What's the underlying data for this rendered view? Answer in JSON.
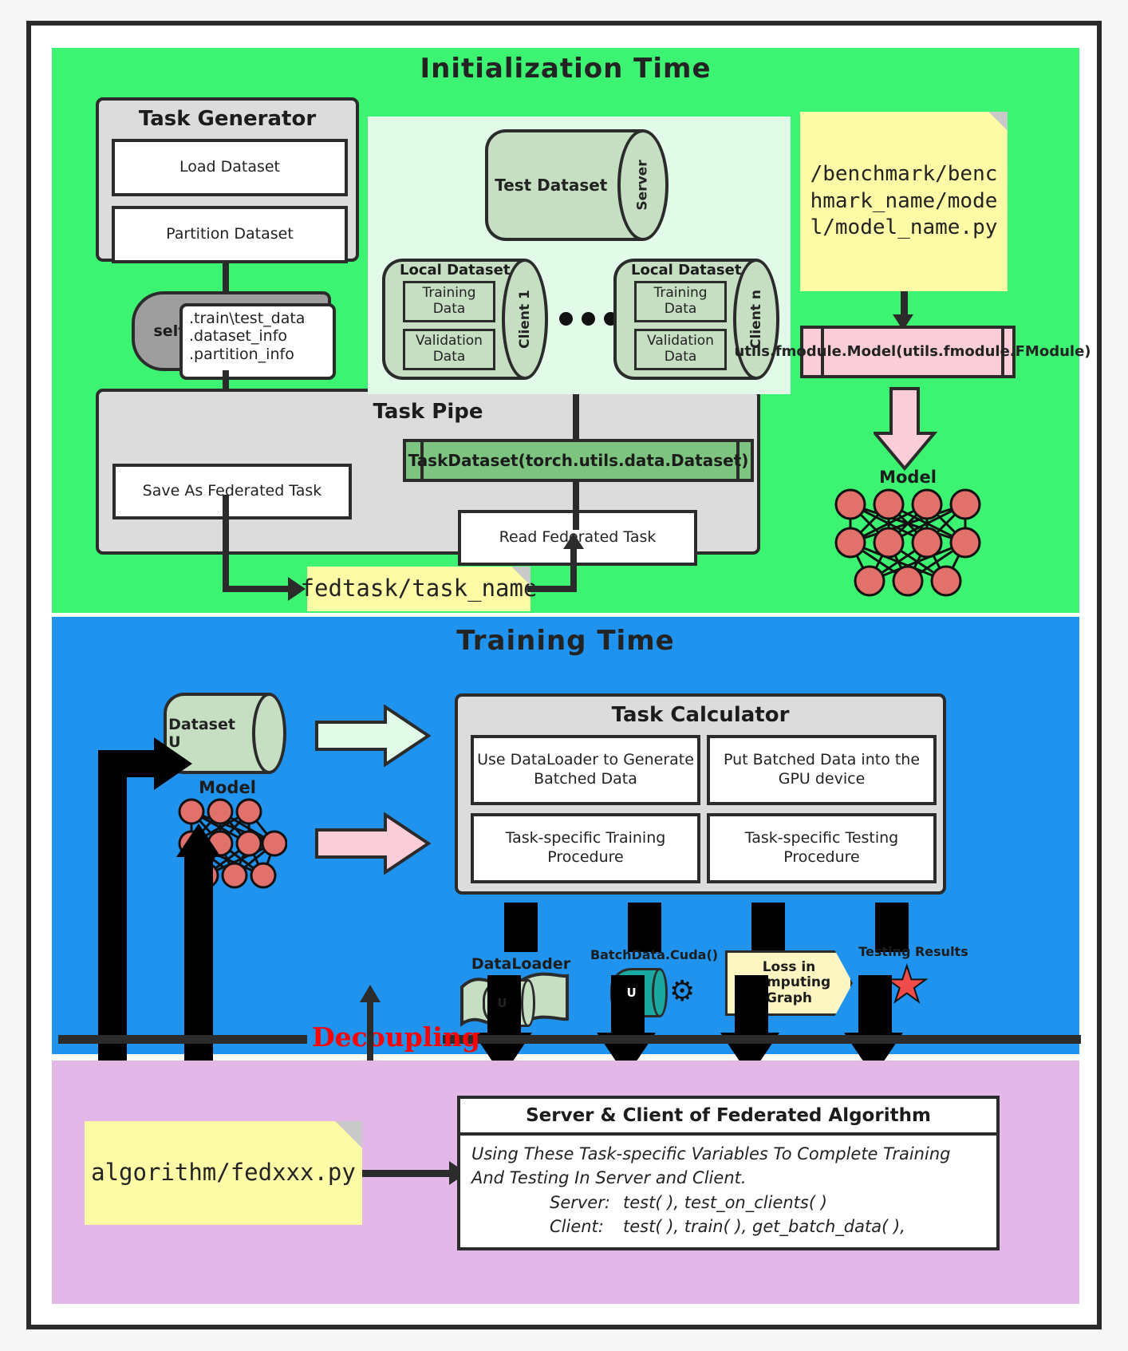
{
  "sections": {
    "init": {
      "title": "Initialization Time"
    },
    "train": {
      "title": "Training Time"
    },
    "decoupling": {
      "label": "Decoupling"
    }
  },
  "task_generator": {
    "title": "Task Generator",
    "items": [
      "Load Dataset",
      "Partition Dataset"
    ]
  },
  "self_note": {
    "tag": "self",
    "lines": [
      ".train\\test_data",
      ".dataset_info",
      ".partition_info"
    ]
  },
  "task_pipe": {
    "title": "Task Pipe",
    "save_box": "Save As Federated Task",
    "read_box": "Read Federated Task",
    "task_dataset_bar": "TaskDataset(torch.utils.data.Dataset)"
  },
  "fedtask_note": "fedtask/task_name",
  "data_panel": {
    "server_cylinder": {
      "label": "Test Dataset",
      "cap": "Server"
    },
    "clients": [
      {
        "title": "Local Dataset",
        "cap": "Client 1",
        "rows": [
          "Training Data",
          "Validation Data"
        ]
      },
      {
        "title": "Local Dataset",
        "cap": "Client n",
        "rows": [
          "Training Data",
          "Validation Data"
        ]
      }
    ],
    "ellipsis": "•••"
  },
  "benchmark_note": "/benchmark/benchmark_name/model/model_name.py",
  "fmodule_box": "utils.fmodule.Model(utils.fmodule.FModule)",
  "model_label_init": "Model",
  "training": {
    "dataset_cylinder": "Dataset U",
    "model_label": "Model",
    "task_calculator": {
      "title": "Task Calculator",
      "cells": [
        "Use DataLoader to Generate Batched Data",
        "Put Batched Data into the GPU device",
        "Task-specific Training Procedure",
        "Task-specific Testing Procedure"
      ]
    },
    "artifacts": [
      {
        "label": "DataLoader",
        "sub": "U",
        "kind": "flag-cylinder"
      },
      {
        "label": "BatchData.Cuda()",
        "sub": "U",
        "kind": "cylinder-gear"
      },
      {
        "label": "Loss in Computing Graph",
        "sub": "",
        "kind": "hex-note"
      },
      {
        "label": "Testing Results",
        "sub": "",
        "kind": "star"
      }
    ]
  },
  "algorithm_note": "algorithm/fedxxx.py",
  "server_client": {
    "title": "Server & Client of Federated Algorithm",
    "intro": "Using These Task-specific Variables To Complete Training And Testing In Server and Client.",
    "rows": [
      {
        "role": "Server:",
        "methods": "test( ), test_on_clients( )"
      },
      {
        "role": "Client:",
        "methods": "test( ), train( ), get_batch_data( ),"
      }
    ]
  },
  "colors": {
    "init_bg": "#3df472",
    "train_bg": "#2093ef",
    "decoupling_bg": "#e3b8e8",
    "note_yellow": "#fdfba6",
    "pink": "#fbcdd8",
    "cyl_green": "#c6dfc3",
    "node_red": "#e2706b",
    "decoupling_text": "#ff0000"
  }
}
